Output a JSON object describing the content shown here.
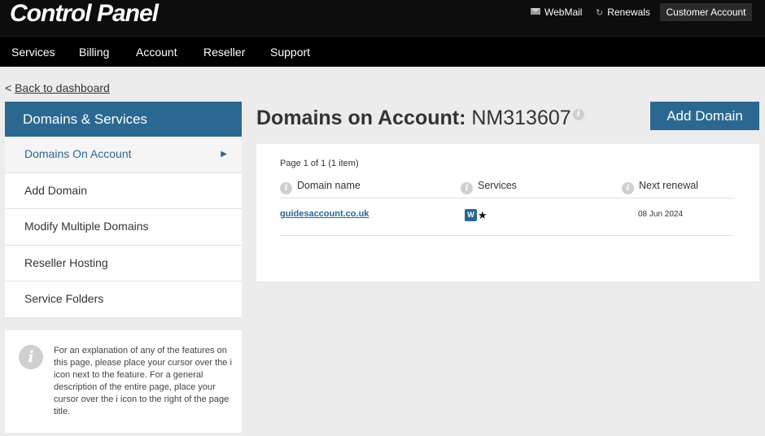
{
  "header": {
    "brand": "Control Panel",
    "webmail": "WebMail",
    "renewals": "Renewals",
    "customer_account": "Customer Account"
  },
  "nav": [
    "Services",
    "Billing",
    "Account",
    "Reseller",
    "Support"
  ],
  "back": {
    "prefix": "<",
    "label": "Back to dashboard"
  },
  "sidebar": {
    "title": "Domains & Services",
    "items": [
      {
        "label": "Domains On Account",
        "active": true
      },
      {
        "label": "Add Domain"
      },
      {
        "label": "Modify Multiple Domains"
      },
      {
        "label": "Reseller Hosting"
      },
      {
        "label": "Service Folders"
      }
    ],
    "info": "For an explanation of any of the features on this page, please place your cursor over the i icon next to the feature. For a general description of the entire page, place your cursor over the i icon to the right of the page title."
  },
  "main": {
    "title_label": "Domains on Account:",
    "account_id": "NM313607",
    "add_button": "Add Domain",
    "pagination": "Page 1 of 1 (1 item)",
    "columns": [
      "Domain name",
      "Services",
      "Next renewal"
    ],
    "rows": [
      {
        "domain": "guidesaccount.co.uk",
        "services": [
          "wordpress-icon",
          "star-icon"
        ],
        "renewal": "08 Jun 2024"
      }
    ]
  },
  "icons": {
    "info": "info-icon",
    "mail": "mail-icon",
    "renewals": "refresh-icon",
    "arrow": "triangle-right-icon"
  },
  "colors": {
    "accent": "#2b6891",
    "topbar": "#0d0d0d",
    "background": "#ececec"
  }
}
